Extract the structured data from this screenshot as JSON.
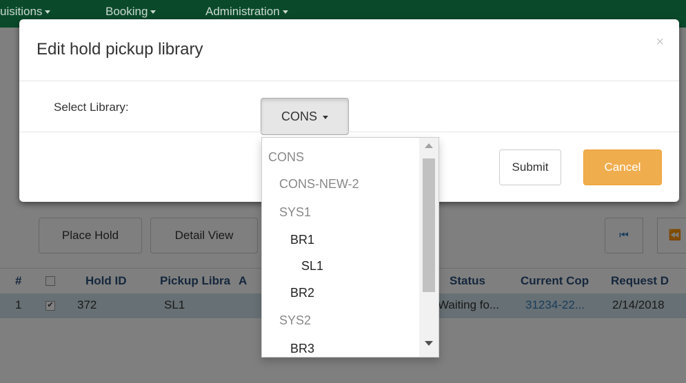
{
  "topnav": {
    "items": [
      {
        "label": "uisitions"
      },
      {
        "label": "Booking"
      },
      {
        "label": "Administration"
      }
    ]
  },
  "toolbar": {
    "place_hold": "Place Hold",
    "detail_view": "Detail View",
    "first_page": "⏮",
    "prev_page": "⏪"
  },
  "grid": {
    "headers": {
      "num": "#",
      "hold_id": "Hold ID",
      "pickup": "Pickup Libra",
      "a": "A",
      "status": "Status",
      "copy": "Current Cop",
      "request": "Request D"
    },
    "row": {
      "num": "1",
      "hold_id": "372",
      "pickup": "SL1",
      "status": "Waiting fo...",
      "copy": "31234-22...",
      "request": "2/14/2018"
    }
  },
  "modal": {
    "title": "Edit hold pickup library",
    "close": "×",
    "field_label": "Select Library:",
    "selected_value": "CONS",
    "submit_label": "Submit",
    "cancel_label": "Cancel"
  },
  "dropdown": {
    "options": [
      {
        "label": "CONS",
        "enabled": false
      },
      {
        "label": "CONS-NEW-2",
        "enabled": false
      },
      {
        "label": "SYS1",
        "enabled": false
      },
      {
        "label": "BR1",
        "enabled": true
      },
      {
        "label": "SL1",
        "enabled": true
      },
      {
        "label": "BR2",
        "enabled": true
      },
      {
        "label": "SYS2",
        "enabled": false
      },
      {
        "label": "BR3",
        "enabled": true
      }
    ]
  },
  "colors": {
    "topnav": "#0a4a2a",
    "accent_cancel": "#f0ad4e",
    "link": "#337ab7"
  }
}
